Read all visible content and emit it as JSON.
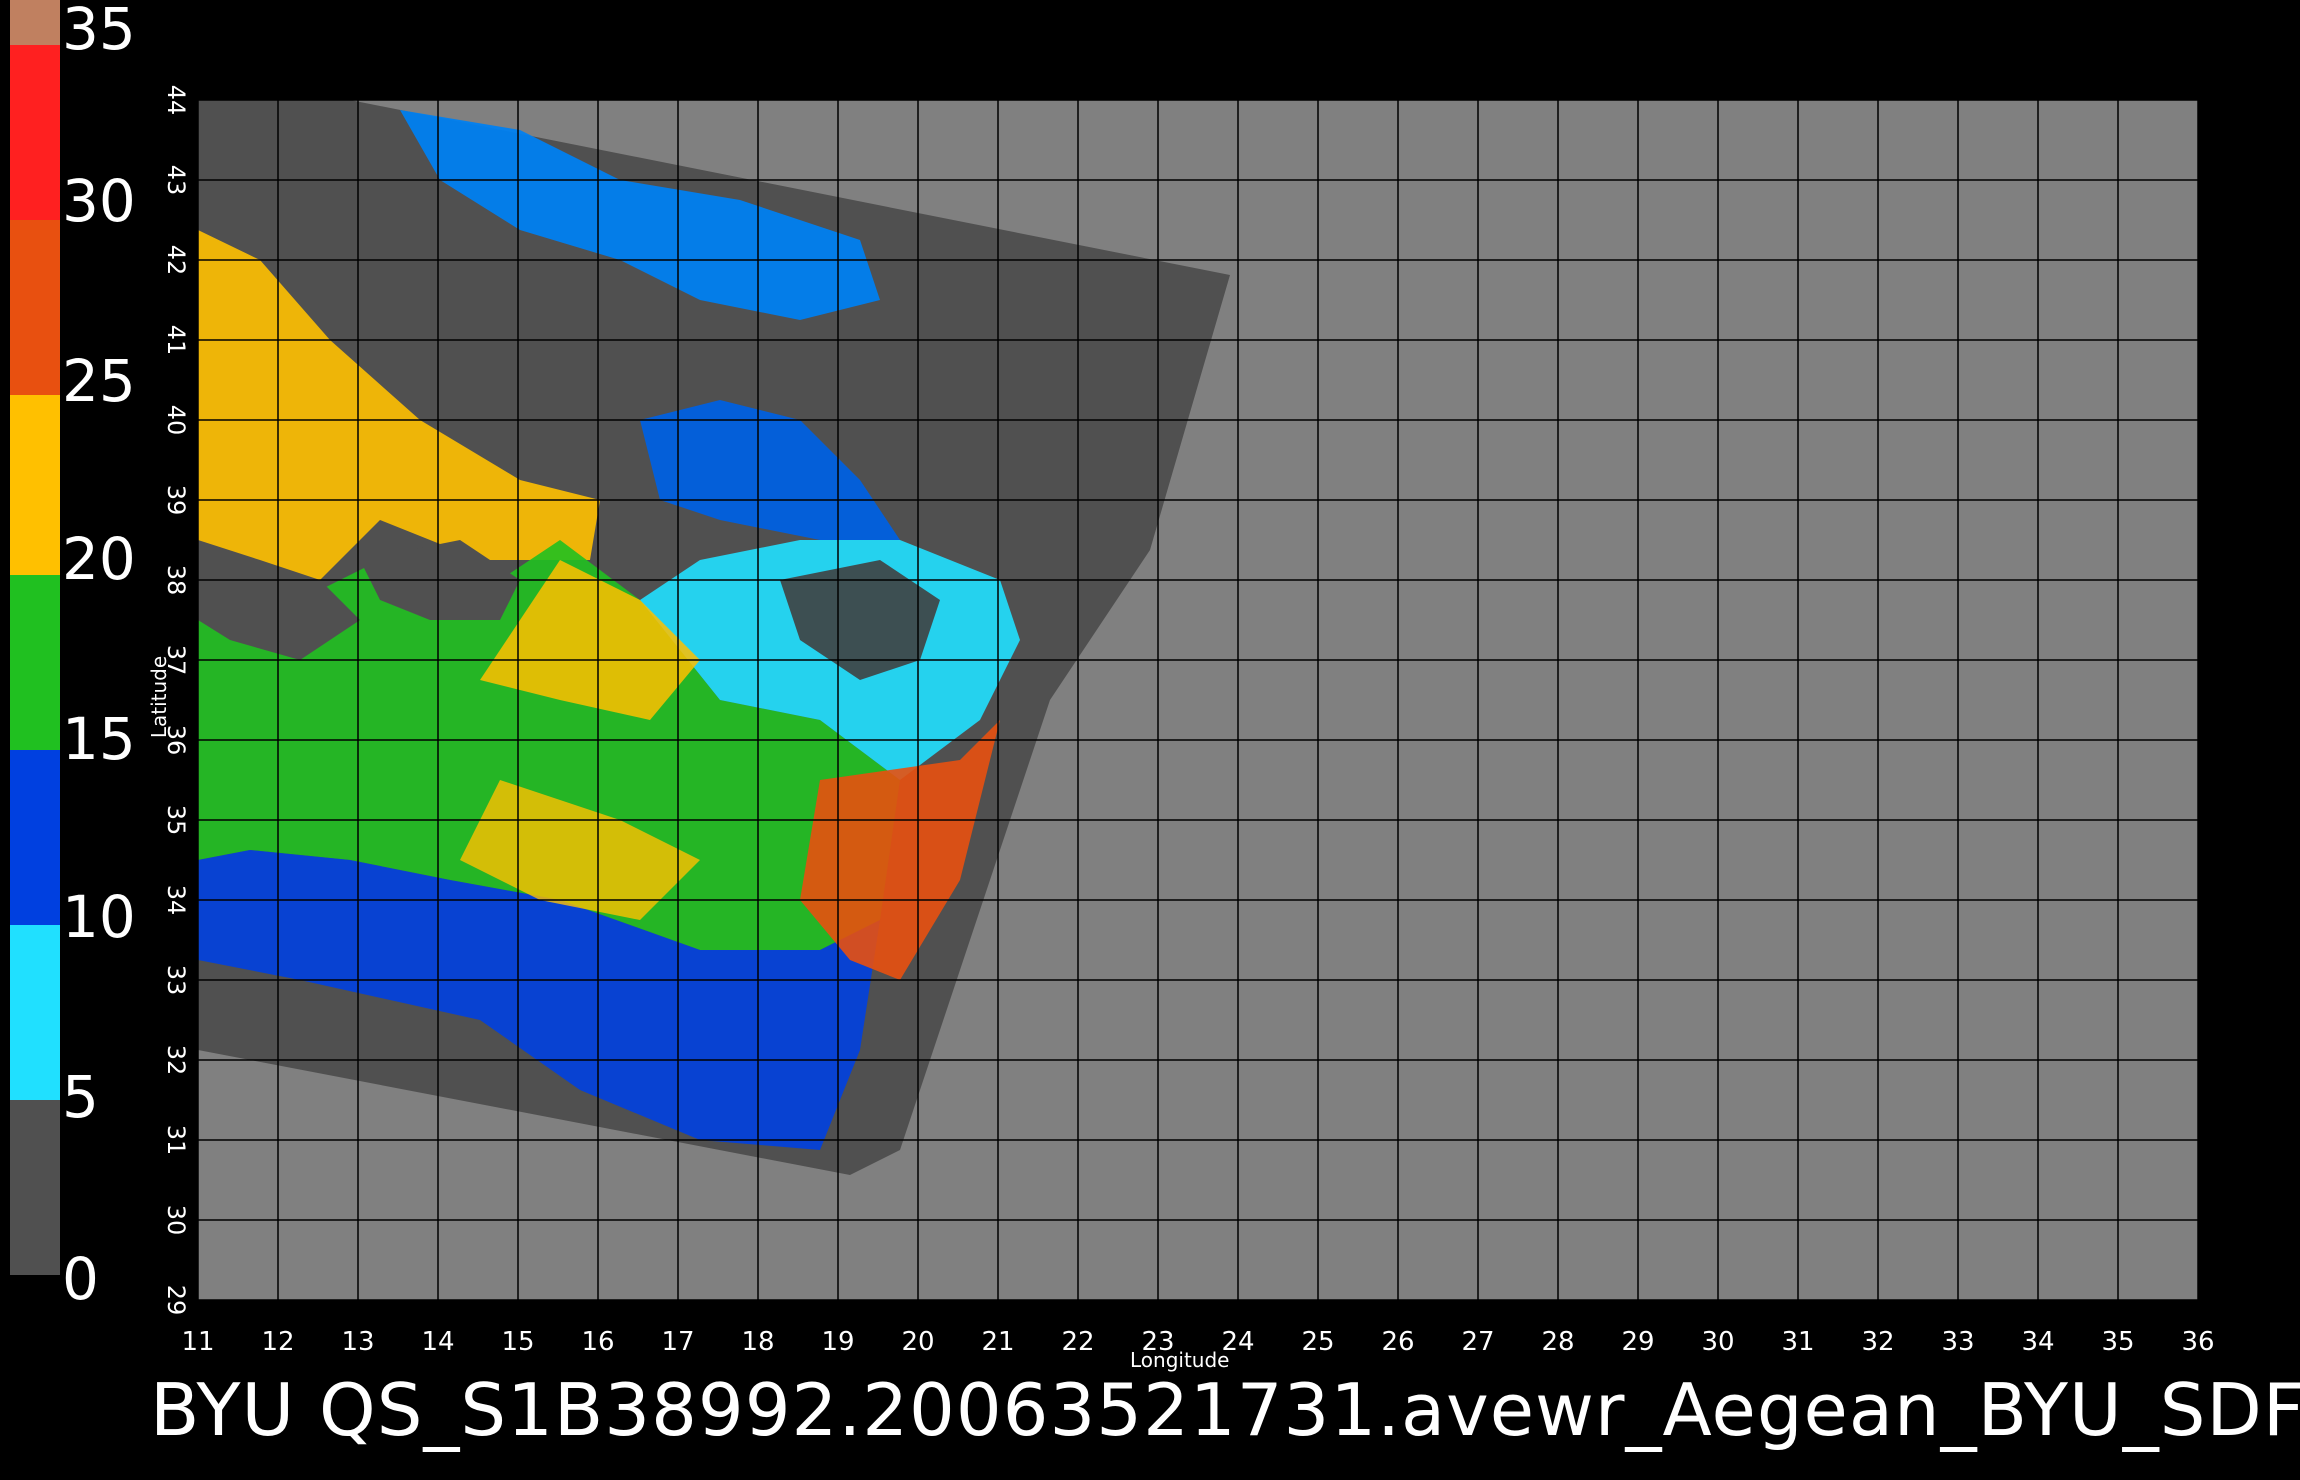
{
  "colorbar": {
    "labels": [
      "35",
      "30",
      "25",
      "20",
      "15",
      "10",
      "5",
      "0"
    ],
    "colors": [
      "#c08060",
      "#ff2020",
      "#e85010",
      "#ffc000",
      "#20c020",
      "#0040e0",
      "#20e0ff",
      "#505050"
    ]
  },
  "axes": {
    "xlabel": "Longitude",
    "ylabel": "Latitude",
    "x_ticks": [
      "11",
      "12",
      "13",
      "14",
      "15",
      "16",
      "17",
      "18",
      "19",
      "20",
      "21",
      "22",
      "23",
      "24",
      "25",
      "26",
      "27",
      "28",
      "29",
      "30",
      "31",
      "32",
      "33",
      "34",
      "35",
      "36"
    ],
    "y_ticks": [
      "29",
      "30",
      "31",
      "32",
      "33",
      "34",
      "35",
      "36",
      "37",
      "38",
      "39",
      "40",
      "41",
      "42",
      "43",
      "44"
    ]
  },
  "footer": {
    "text": "BYU  QS_S1B38992.20063521731.avewr_Aegean_BYU_SDF"
  },
  "colors": {
    "background": "#000000",
    "nodata": "#808080",
    "land": "#505050"
  }
}
